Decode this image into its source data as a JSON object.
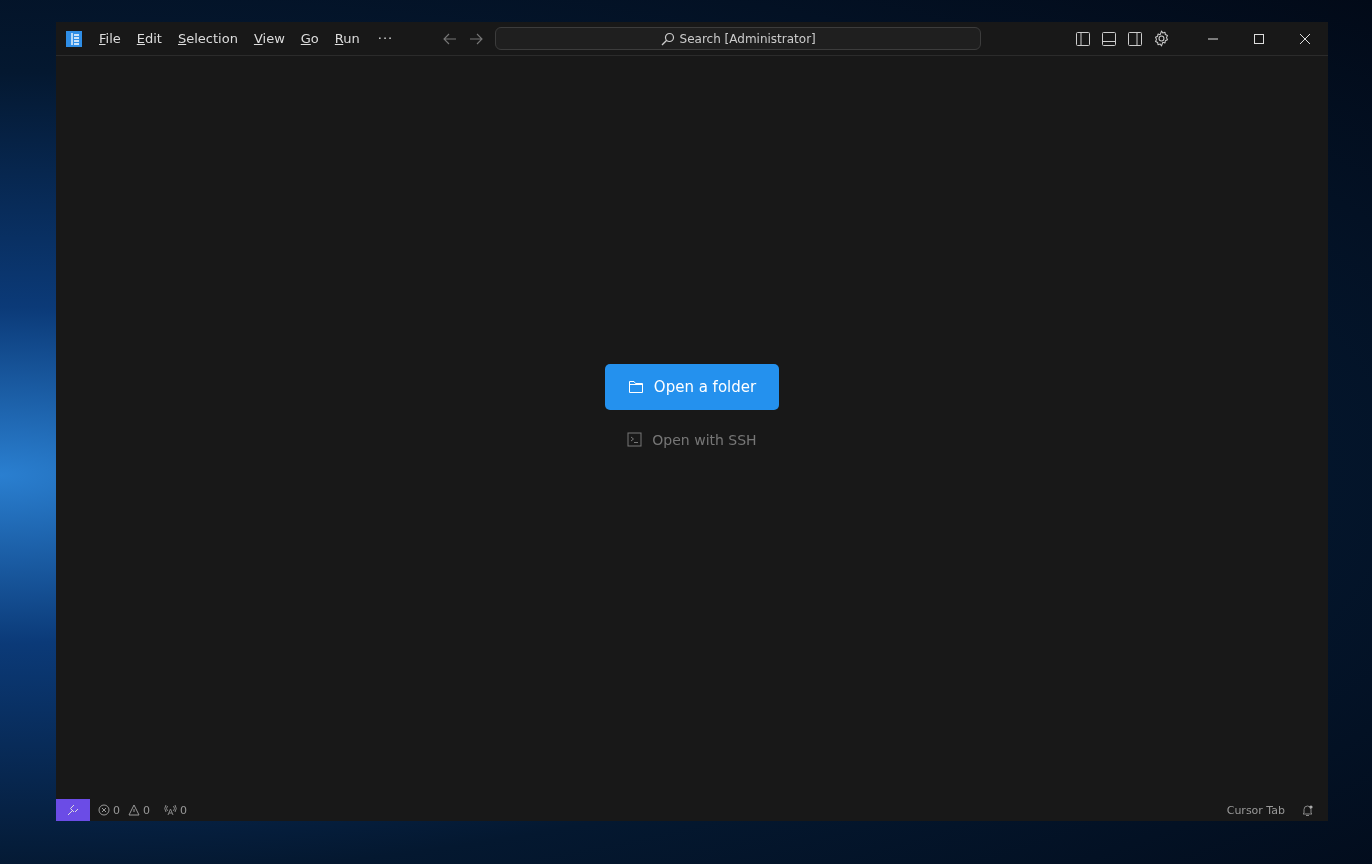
{
  "menu": [
    "File",
    "Edit",
    "Selection",
    "View",
    "Go",
    "Run"
  ],
  "more": "···",
  "search": {
    "label": "Search [Administrator]"
  },
  "actions": [
    {
      "kind": "primary",
      "label": "Open a folder"
    },
    {
      "kind": "secondary",
      "label": "Open with SSH"
    }
  ],
  "status_bar": {
    "problems": [
      {
        "kind": "error",
        "count": "0"
      },
      {
        "kind": "warning",
        "count": "0"
      }
    ],
    "ports": "0",
    "right": "Cursor Tab"
  }
}
